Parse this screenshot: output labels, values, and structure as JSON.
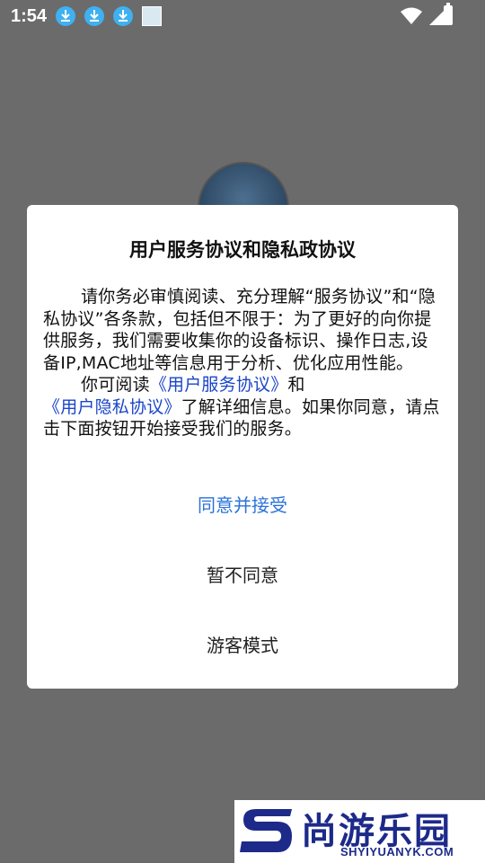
{
  "status_bar": {
    "time": "1:54"
  },
  "dialog": {
    "title": "用户服务协议和隐私政协议",
    "paragraph1": "请你务必审慎阅读、充分理解“服务协议”和“隐私协议”各条款，包括但不限于：为了更好的向你提供服务，我们需要收集你的设备标识、操作日志,设备IP,MAC地址等信息用于分析、优化应用性能。",
    "paragraph2_prefix": "你可阅读",
    "link_service": "《用户服务协议》",
    "paragraph2_and": "和",
    "link_privacy": "《用户隐私协议》",
    "paragraph2_suffix": "了解详细信息。如果你同意，请点击下面按钮开始接受我们的服务。",
    "accept_label": "同意并接受",
    "decline_label": "暂不同意",
    "guest_label": "游客模式"
  },
  "watermark": {
    "name": "尚游乐园",
    "url": "SHYIYUANYK.COM"
  },
  "colors": {
    "accent": "#2a72d9",
    "link": "#1a45c9",
    "overlay": "#6b6b6b"
  }
}
